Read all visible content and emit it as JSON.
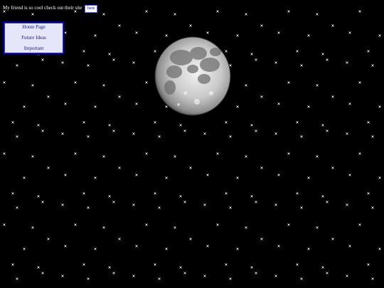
{
  "header": {
    "message": "My friend is so cool check out their site",
    "link_label": "here"
  },
  "nav": {
    "items": [
      {
        "label": "Home Page"
      },
      {
        "label": "Future Ideas"
      },
      {
        "label": "Important"
      }
    ]
  },
  "colors": {
    "background": "#000000",
    "nav_background": "#e6e6fa",
    "nav_border": "#00008b",
    "nav_text": "#1a1a7a",
    "link_text": "#0000cc",
    "star": "#ffffff"
  },
  "icons": {
    "star": "sparkle-star-icon",
    "moon": "moon-icon"
  }
}
